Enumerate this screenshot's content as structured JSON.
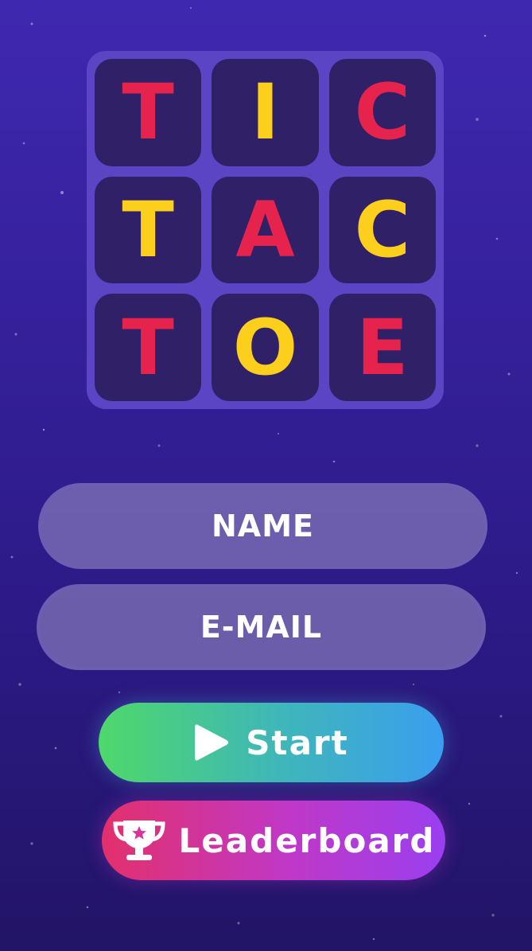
{
  "board": {
    "cells": [
      {
        "letter": "T",
        "color": "red"
      },
      {
        "letter": "I",
        "color": "yellow"
      },
      {
        "letter": "C",
        "color": "red"
      },
      {
        "letter": "T",
        "color": "yellow"
      },
      {
        "letter": "A",
        "color": "red"
      },
      {
        "letter": "C",
        "color": "yellow"
      },
      {
        "letter": "T",
        "color": "red"
      },
      {
        "letter": "O",
        "color": "yellow"
      },
      {
        "letter": "E",
        "color": "red"
      }
    ]
  },
  "form": {
    "name_placeholder": "NAME",
    "email_placeholder": "E-MAIL"
  },
  "buttons": {
    "start_label": "Start",
    "start_icon": "play-icon",
    "leaderboard_label": "Leaderboard",
    "leaderboard_icon": "trophy-icon"
  },
  "colors": {
    "letter_red": "#e6234d",
    "letter_yellow": "#fccf1c",
    "board_bg": "#5c45c4",
    "cell_bg": "#2f2067",
    "start_gradient": [
      "#4fd86a",
      "#3a9ef0"
    ],
    "leaderboard_gradient": [
      "#e3306c",
      "#9a3ff0"
    ]
  }
}
